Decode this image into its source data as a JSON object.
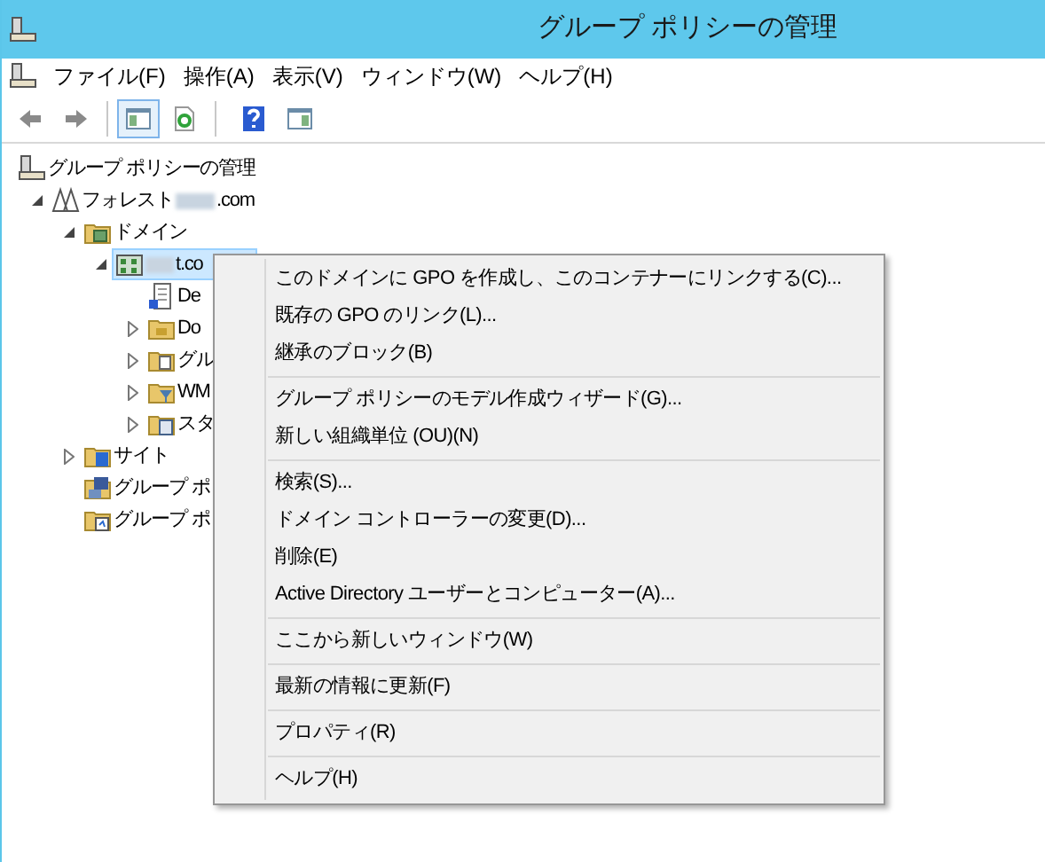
{
  "window": {
    "title": "グループ ポリシーの管理"
  },
  "menu_bar": [
    "ファイル(F)",
    "操作(A)",
    "表示(V)",
    "ウィンドウ(W)",
    "ヘルプ(H)"
  ],
  "toolbar": [
    {
      "kind": "back",
      "selected": false
    },
    {
      "kind": "forward",
      "selected": false
    },
    {
      "kind": "separator"
    },
    {
      "kind": "console-tree",
      "selected": true
    },
    {
      "kind": "refresh",
      "selected": false
    },
    {
      "kind": "separator"
    },
    {
      "kind": "help",
      "selected": false
    },
    {
      "kind": "action-pane",
      "selected": false
    }
  ],
  "tree": [
    {
      "label": "グループ ポリシーの管理",
      "kind": "console",
      "selected": false,
      "children": [
        {
          "label": "フォレスト",
          "suffix": ".com",
          "redacted": true,
          "kind": "forest",
          "selected": false,
          "expanded": true,
          "children": [
            {
              "label": "ドメイン",
              "kind": "domains",
              "selected": false,
              "expanded": true,
              "children": [
                {
                  "label": "t.co",
                  "redacted": true,
                  "kind": "domain",
                  "selected": true,
                  "expanded": true,
                  "children": [
                    {
                      "label": "De",
                      "kind": "policy",
                      "selected": false
                    },
                    {
                      "label": "Do",
                      "kind": "ou",
                      "selected": false,
                      "expanded": false
                    },
                    {
                      "label": "グル",
                      "kind": "gpo-folder",
                      "selected": false,
                      "expanded": false
                    },
                    {
                      "label": "WM",
                      "kind": "filter-folder",
                      "selected": false,
                      "expanded": false
                    },
                    {
                      "label": "スタ",
                      "kind": "starter-folder",
                      "selected": false,
                      "expanded": false
                    }
                  ]
                }
              ]
            },
            {
              "label": "サイト",
              "kind": "sites",
              "selected": false,
              "expanded": false
            },
            {
              "label": "グループ ポ",
              "kind": "modeling",
              "selected": false
            },
            {
              "label": "グループ ポ",
              "kind": "results",
              "selected": false
            }
          ]
        }
      ]
    }
  ],
  "context_menu": [
    [
      "このドメインに GPO を作成し、このコンテナーにリンクする(C)...",
      "既存の GPO のリンク(L)...",
      "継承のブロック(B)"
    ],
    [
      "グループ ポリシーのモデル作成ウィザード(G)...",
      "新しい組織単位 (OU)(N)"
    ],
    [
      "検索(S)...",
      "ドメイン コントローラーの変更(D)...",
      "削除(E)",
      "Active Directory ユーザーとコンピューター(A)..."
    ],
    [
      "ここから新しいウィンドウ(W)"
    ],
    [
      "最新の情報に更新(F)"
    ],
    [
      "プロパティ(R)"
    ],
    [
      "ヘルプ(H)"
    ]
  ]
}
